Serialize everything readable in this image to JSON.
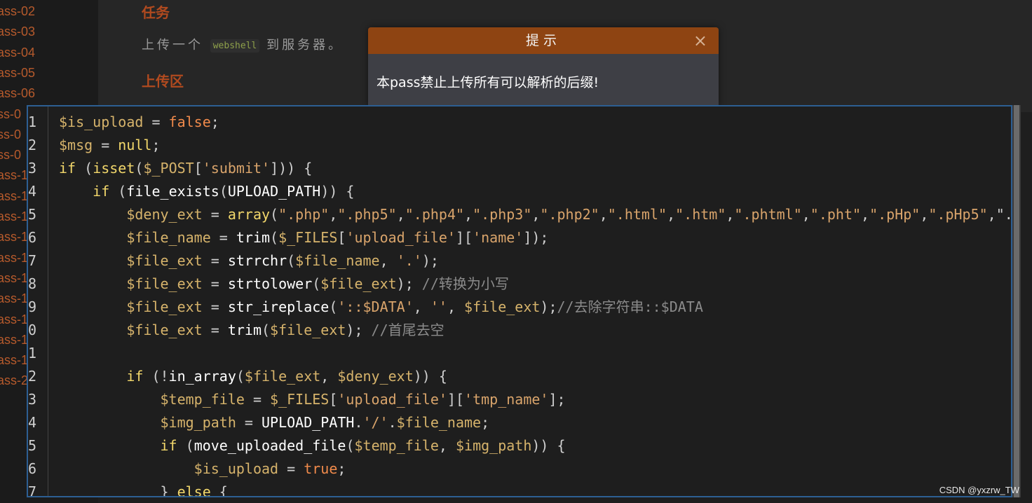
{
  "sidebar": {
    "items": [
      "ass-02",
      "ass-03",
      "ass-04",
      "ass-05",
      "ass-06",
      "ss-0",
      "ss-0",
      "ss-0",
      "ass-1",
      "ass-1",
      "ass-1",
      "ass-1",
      "ass-1",
      "ass-1",
      "ass-1",
      "ass-1",
      "ass-1",
      "ass-1",
      "ass-2"
    ]
  },
  "page": {
    "task_title": "任务",
    "task_text_before": "上传一个",
    "task_code": "webshell",
    "task_text_after": "到服务器。",
    "upload_title": "上传区"
  },
  "modal": {
    "title": "提示",
    "close_icon": "×",
    "message": "本pass禁止上传所有可以解析的后缀!"
  },
  "editor": {
    "line_numbers": [
      "1",
      "2",
      "3",
      "4",
      "5",
      "6",
      "7",
      "8",
      "9",
      "0",
      "1",
      "2",
      "3",
      "4",
      "5",
      "6",
      "7"
    ],
    "code_lines": [
      "$is_upload = false;",
      "$msg = null;",
      "if (isset($_POST['submit'])) {",
      "    if (file_exists(UPLOAD_PATH)) {",
      "        $deny_ext = array(\".php\",\".php5\",\".php4\",\".php3\",\".php2\",\".html\",\".htm\",\".phtml\",\".pht\",\".pHp\",\".pHp5\",\".",
      "        $file_name = trim($_FILES['upload_file']['name']);",
      "        $file_ext = strrchr($file_name, '.');",
      "        $file_ext = strtolower($file_ext); //转换为小写",
      "        $file_ext = str_ireplace('::$DATA', '', $file_ext);//去除字符串::$DATA",
      "        $file_ext = trim($file_ext); //首尾去空",
      "",
      "        if (!in_array($file_ext, $deny_ext)) {",
      "            $temp_file = $_FILES['upload_file']['tmp_name'];",
      "            $img_path = UPLOAD_PATH.'/'.$file_name;",
      "            if (move_uploaded_file($temp_file, $img_path)) {",
      "                $is_upload = true;",
      "            } else {"
    ]
  },
  "watermark": "CSDN @yxzrw_TW",
  "colors": {
    "accent": "#8e4412",
    "editor_border": "#2d5f93",
    "keyword": "#f2d76b",
    "variable": "#d6b36b"
  }
}
